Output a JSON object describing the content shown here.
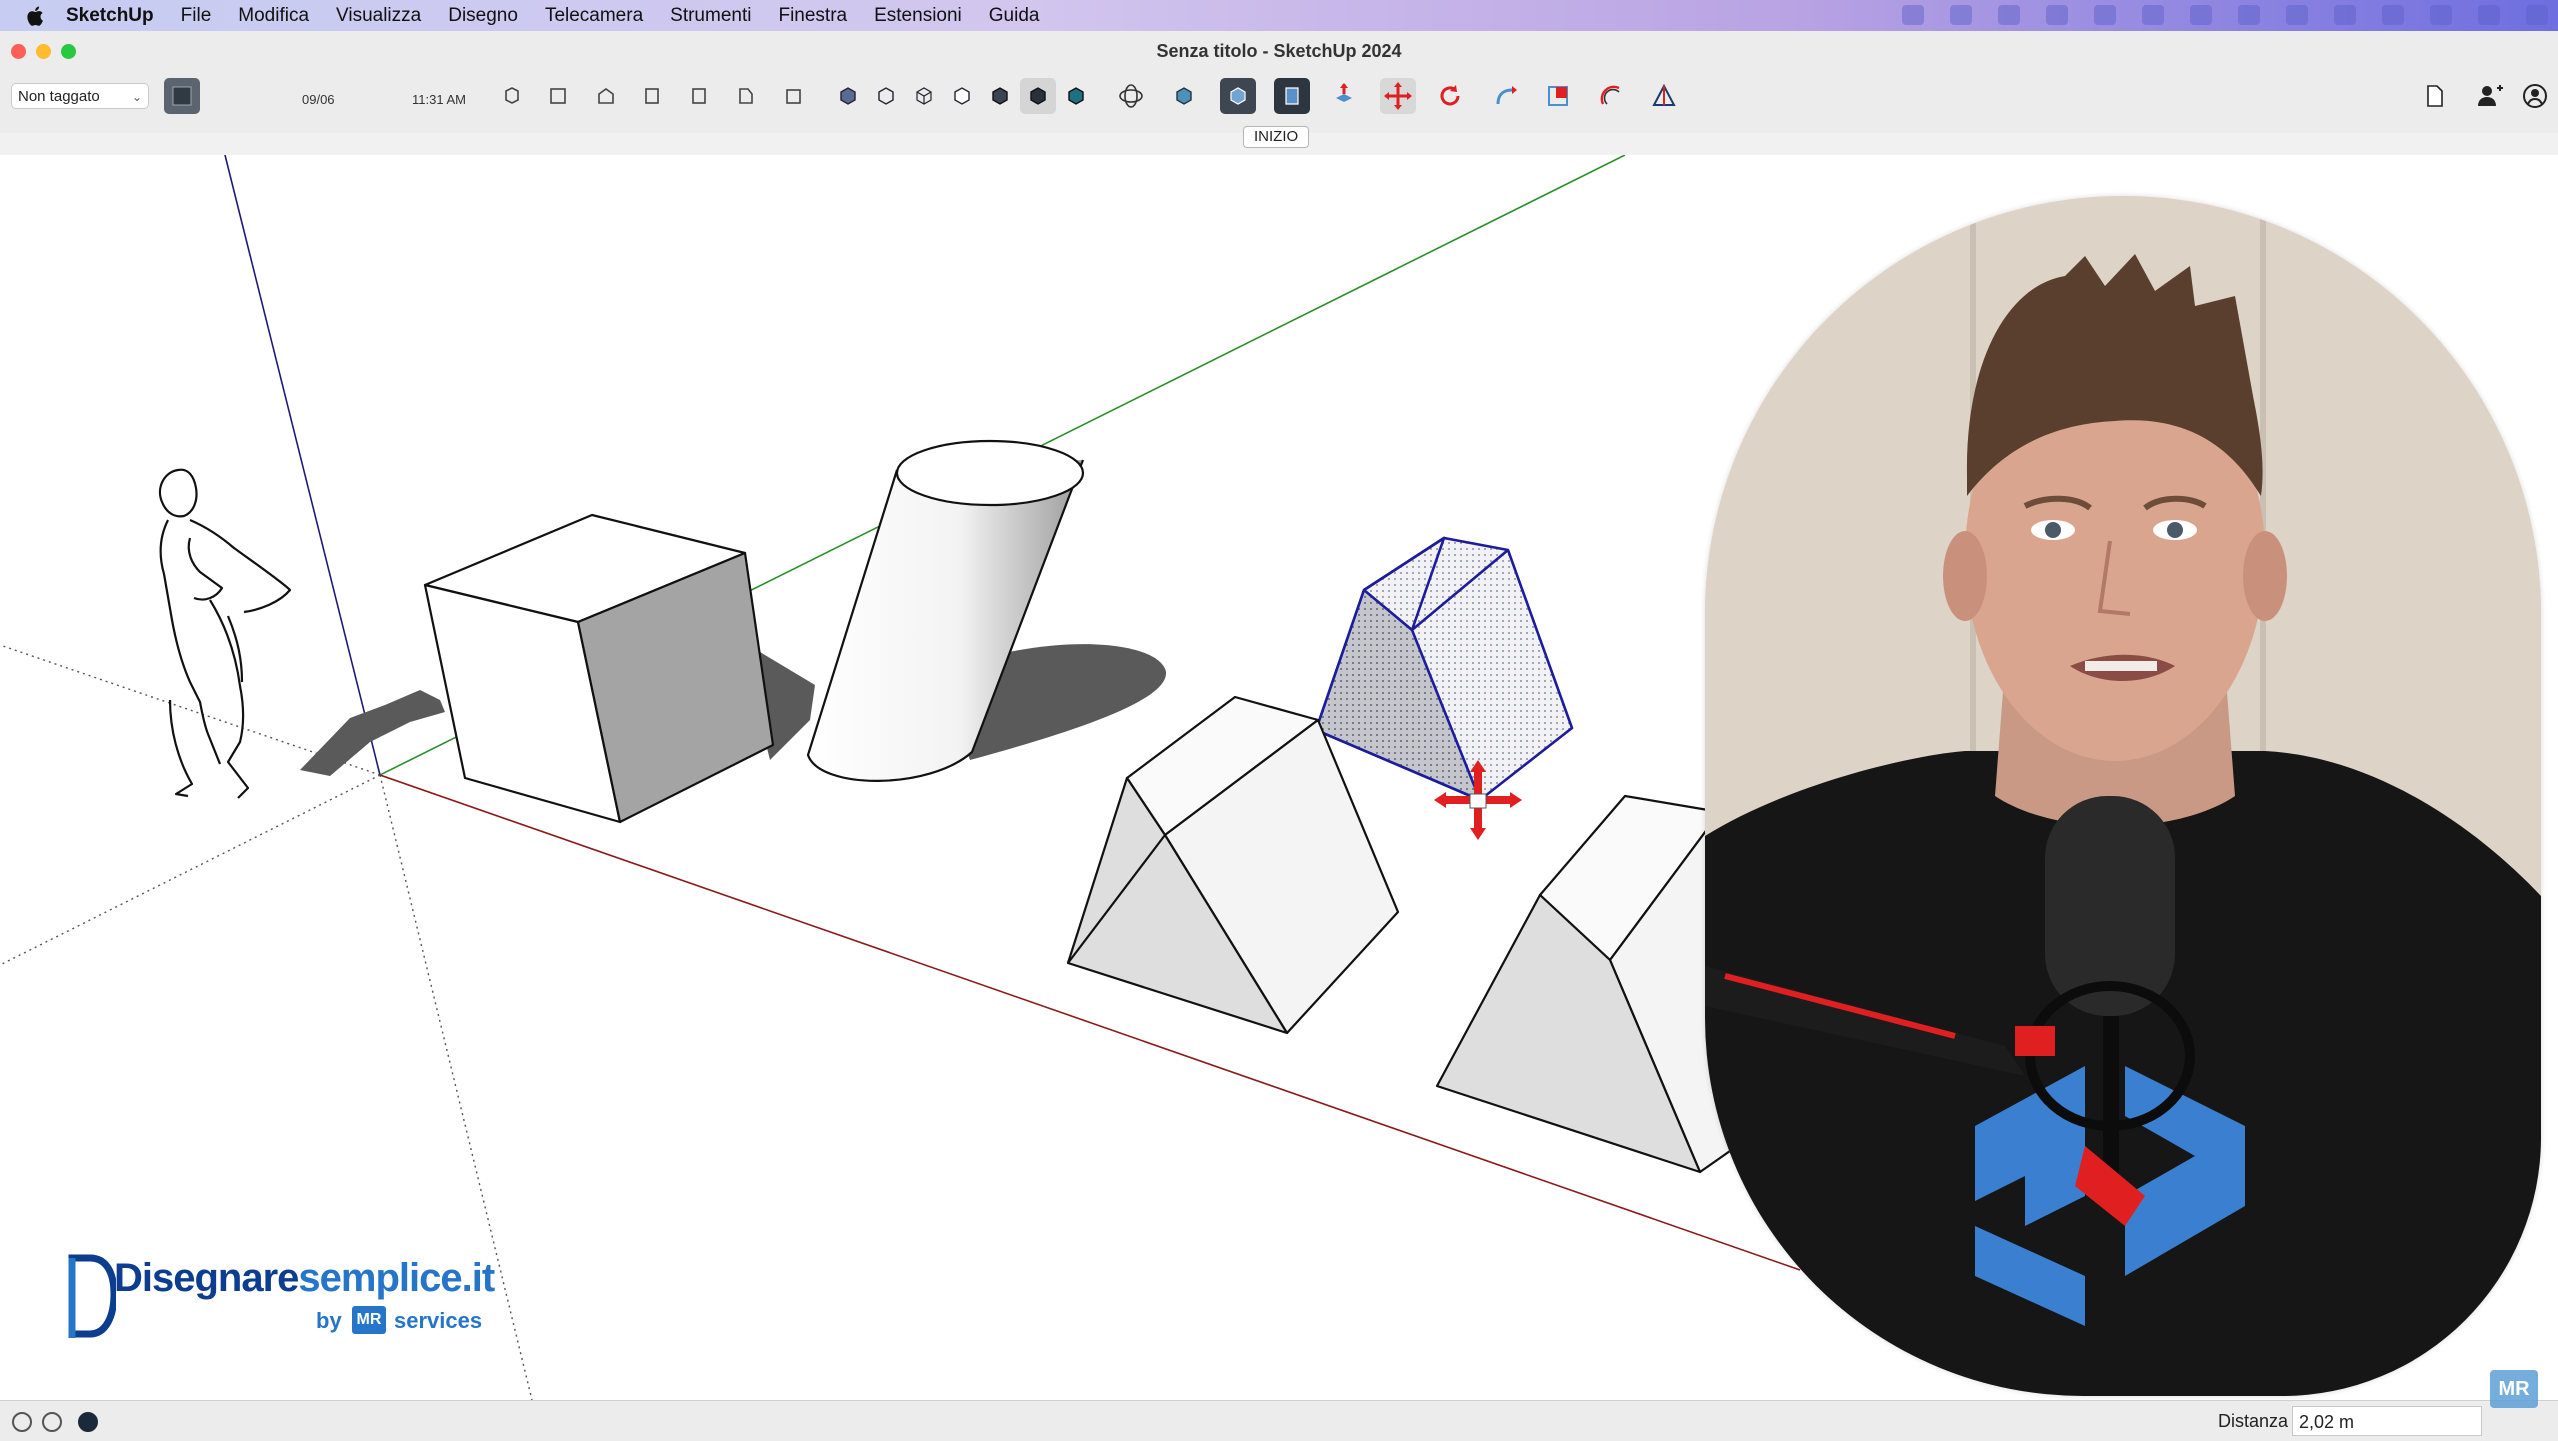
{
  "menubar": {
    "items": [
      "SketchUp",
      "File",
      "Modifica",
      "Visualizza",
      "Disegno",
      "Telecamera",
      "Strumenti",
      "Finestra",
      "Estensioni",
      "Guida"
    ]
  },
  "window": {
    "title": "Senza titolo - SketchUp 2024"
  },
  "toolbar": {
    "tag_value": "Non taggato",
    "shadow_date": "09/06",
    "shadow_time": "11:31 AM"
  },
  "scene_tabs": [
    "INIZIO"
  ],
  "status": {
    "measurement_label": "Distanza",
    "measurement_value": "2,02 m"
  },
  "logo": {
    "name_part1": "Disegnare",
    "name_part2": "semplice.it",
    "by": "by",
    "mr": "MR",
    "services": "services"
  },
  "watermark": "MR",
  "colors": {
    "axis_red": "#8b1a1a",
    "axis_green": "#2a8f2a",
    "axis_blue": "#1a1a7a",
    "selection_blue": "#1c1c9c",
    "move_gizmo": "#e02020",
    "brand_blue": "#2575c8"
  }
}
